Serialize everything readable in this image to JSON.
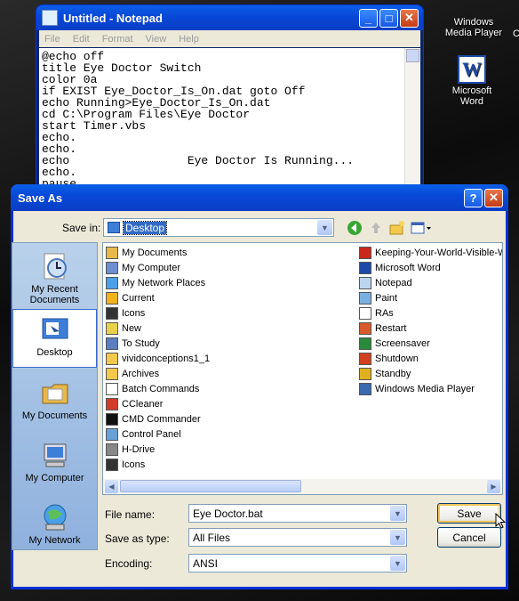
{
  "desktop": {
    "icons": [
      {
        "label": "Windows Media Player",
        "line1": "Windows",
        "line2": "Media Player"
      },
      {
        "label": "Microsoft Word",
        "line1": "Microsoft",
        "line2": "Word"
      }
    ],
    "partial_label": "C"
  },
  "notepad": {
    "title": "Untitled - Notepad",
    "menu": [
      "File",
      "Edit",
      "Format",
      "View",
      "Help"
    ],
    "content": "@echo off\ntitle Eye Doctor Switch\ncolor 0a\nif EXIST Eye_Doctor_Is_On.dat goto Off\necho Running>Eye_Doctor_Is_On.dat\ncd C:\\Program Files\\Eye Doctor\nstart Timer.vbs\necho.\necho.\necho                 Eye Doctor Is Running...\necho.\npause"
  },
  "dialog": {
    "title": "Save As",
    "save_in_label": "Save in:",
    "save_in_value": "Desktop",
    "places": [
      {
        "label": "My Recent Documents",
        "line1": "My Recent",
        "line2": "Documents",
        "icon": "recent-documents-icon"
      },
      {
        "label": "Desktop",
        "line1": "Desktop",
        "line2": "",
        "icon": "desktop-icon",
        "selected": true
      },
      {
        "label": "My Documents",
        "line1": "My Documents",
        "line2": "",
        "icon": "my-documents-icon"
      },
      {
        "label": "My Computer",
        "line1": "My Computer",
        "line2": "",
        "icon": "my-computer-icon"
      },
      {
        "label": "My Network",
        "line1": "My Network",
        "line2": "",
        "icon": "my-network-icon"
      }
    ],
    "files_col1": [
      {
        "name": "My Documents",
        "icon": "folder-documents-icon"
      },
      {
        "name": "My Computer",
        "icon": "computer-icon"
      },
      {
        "name": "My Network Places",
        "icon": "network-places-icon"
      },
      {
        "name": "Current",
        "icon": "warning-icon"
      },
      {
        "name": "Icons",
        "icon": "folder-dark-icon"
      },
      {
        "name": "New",
        "icon": "star-icon"
      },
      {
        "name": "To Study",
        "icon": "shortcut-icon"
      },
      {
        "name": "vividconceptions1_1",
        "icon": "folder-icon"
      },
      {
        "name": "Archives",
        "icon": "folder-icon"
      },
      {
        "name": "Batch Commands",
        "icon": "document-icon"
      },
      {
        "name": "CCleaner",
        "icon": "ccleaner-icon"
      },
      {
        "name": "CMD Commander",
        "icon": "cmd-icon"
      },
      {
        "name": "Control Panel",
        "icon": "control-panel-icon"
      },
      {
        "name": "H-Drive",
        "icon": "drive-icon"
      },
      {
        "name": "Icons",
        "icon": "folder-dark-icon"
      }
    ],
    "files_col2": [
      {
        "name": "Keeping-Your-World-Visible-W",
        "icon": "pdf-icon"
      },
      {
        "name": "Microsoft Word",
        "icon": "word-icon"
      },
      {
        "name": "Notepad",
        "icon": "notepad-icon"
      },
      {
        "name": "Paint",
        "icon": "paint-icon"
      },
      {
        "name": "RAs",
        "icon": "document-icon"
      },
      {
        "name": "Restart",
        "icon": "restart-icon"
      },
      {
        "name": "Screensaver",
        "icon": "screensaver-icon"
      },
      {
        "name": "Shutdown",
        "icon": "shutdown-icon"
      },
      {
        "name": "Standby",
        "icon": "standby-icon"
      },
      {
        "name": "Windows Media Player",
        "icon": "media-player-icon"
      }
    ],
    "file_name_label": "File name:",
    "file_name_value": "Eye Doctor.bat",
    "save_type_label": "Save as type:",
    "save_type_value": "All Files",
    "encoding_label": "Encoding:",
    "encoding_value": "ANSI",
    "save_button": "Save",
    "cancel_button": "Cancel"
  },
  "colors": {
    "title_blue": "#0a54e0",
    "dialog_bg": "#ece9d8",
    "places_bg": "#a9c4e8"
  }
}
